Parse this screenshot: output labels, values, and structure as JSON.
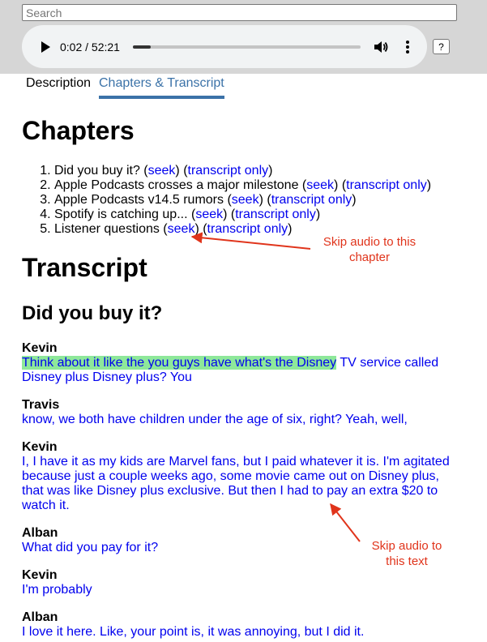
{
  "search": {
    "placeholder": "Search"
  },
  "player": {
    "current_time": "0:02",
    "separator": " / ",
    "duration": "52:21",
    "progress_fraction": 0.0006
  },
  "help_label": "?",
  "tabs": [
    {
      "label": "Description",
      "active": false
    },
    {
      "label": "Chapters & Transcript",
      "active": true
    }
  ],
  "chapters_heading": "Chapters",
  "chapters": [
    {
      "num": "1.",
      "title": "Did you buy it?",
      "seek": "seek",
      "transcript": "transcript only"
    },
    {
      "num": "2.",
      "title": "Apple Podcasts crosses a major milestone",
      "seek": "seek",
      "transcript": "transcript only"
    },
    {
      "num": "3.",
      "title": "Apple Podcasts v14.5 rumors",
      "seek": "seek",
      "transcript": "transcript only"
    },
    {
      "num": "4.",
      "title": "Spotify is catching up...",
      "seek": "seek",
      "transcript": "transcript only"
    },
    {
      "num": "5.",
      "title": "Listener questions",
      "seek": "seek",
      "transcript": "transcript only"
    }
  ],
  "annotations": {
    "chapter_note_line1": "Skip audio to this",
    "chapter_note_line2": "chapter",
    "text_note_line1": "Skip audio to",
    "text_note_line2": "this text",
    "color": "#e0341b"
  },
  "transcript_heading": "Transcript",
  "section_heading": "Did you buy it?",
  "transcript": [
    {
      "speaker": "Kevin",
      "highlight": "Think about it like the you guys have what's the Disney",
      "text": " TV service called Disney plus Disney plus? You"
    },
    {
      "speaker": "Travis",
      "highlight": "",
      "text": "know, we both have children under the age of six, right? Yeah, well,"
    },
    {
      "speaker": "Kevin",
      "highlight": "",
      "text": "I, I have it as my kids are Marvel fans, but I paid whatever it is. I'm agitated because just a couple weeks ago, some movie came out on Disney plus, that was like Disney plus exclusive. But then I had to pay an extra $20 to watch it."
    },
    {
      "speaker": "Alban",
      "highlight": "",
      "text": "What did you pay for it?"
    },
    {
      "speaker": "Kevin",
      "highlight": "",
      "text": "I'm probably"
    },
    {
      "speaker": "Alban",
      "highlight": "",
      "text": "I love it here. Like, your point is, it was annoying, but I did it."
    }
  ],
  "colors": {
    "link": "#0000ee",
    "tab_active": "#3b72a8",
    "highlight": "#8ee89a",
    "topbar_bg": "#d6d6d6",
    "player_bg": "#f1f3f4"
  }
}
